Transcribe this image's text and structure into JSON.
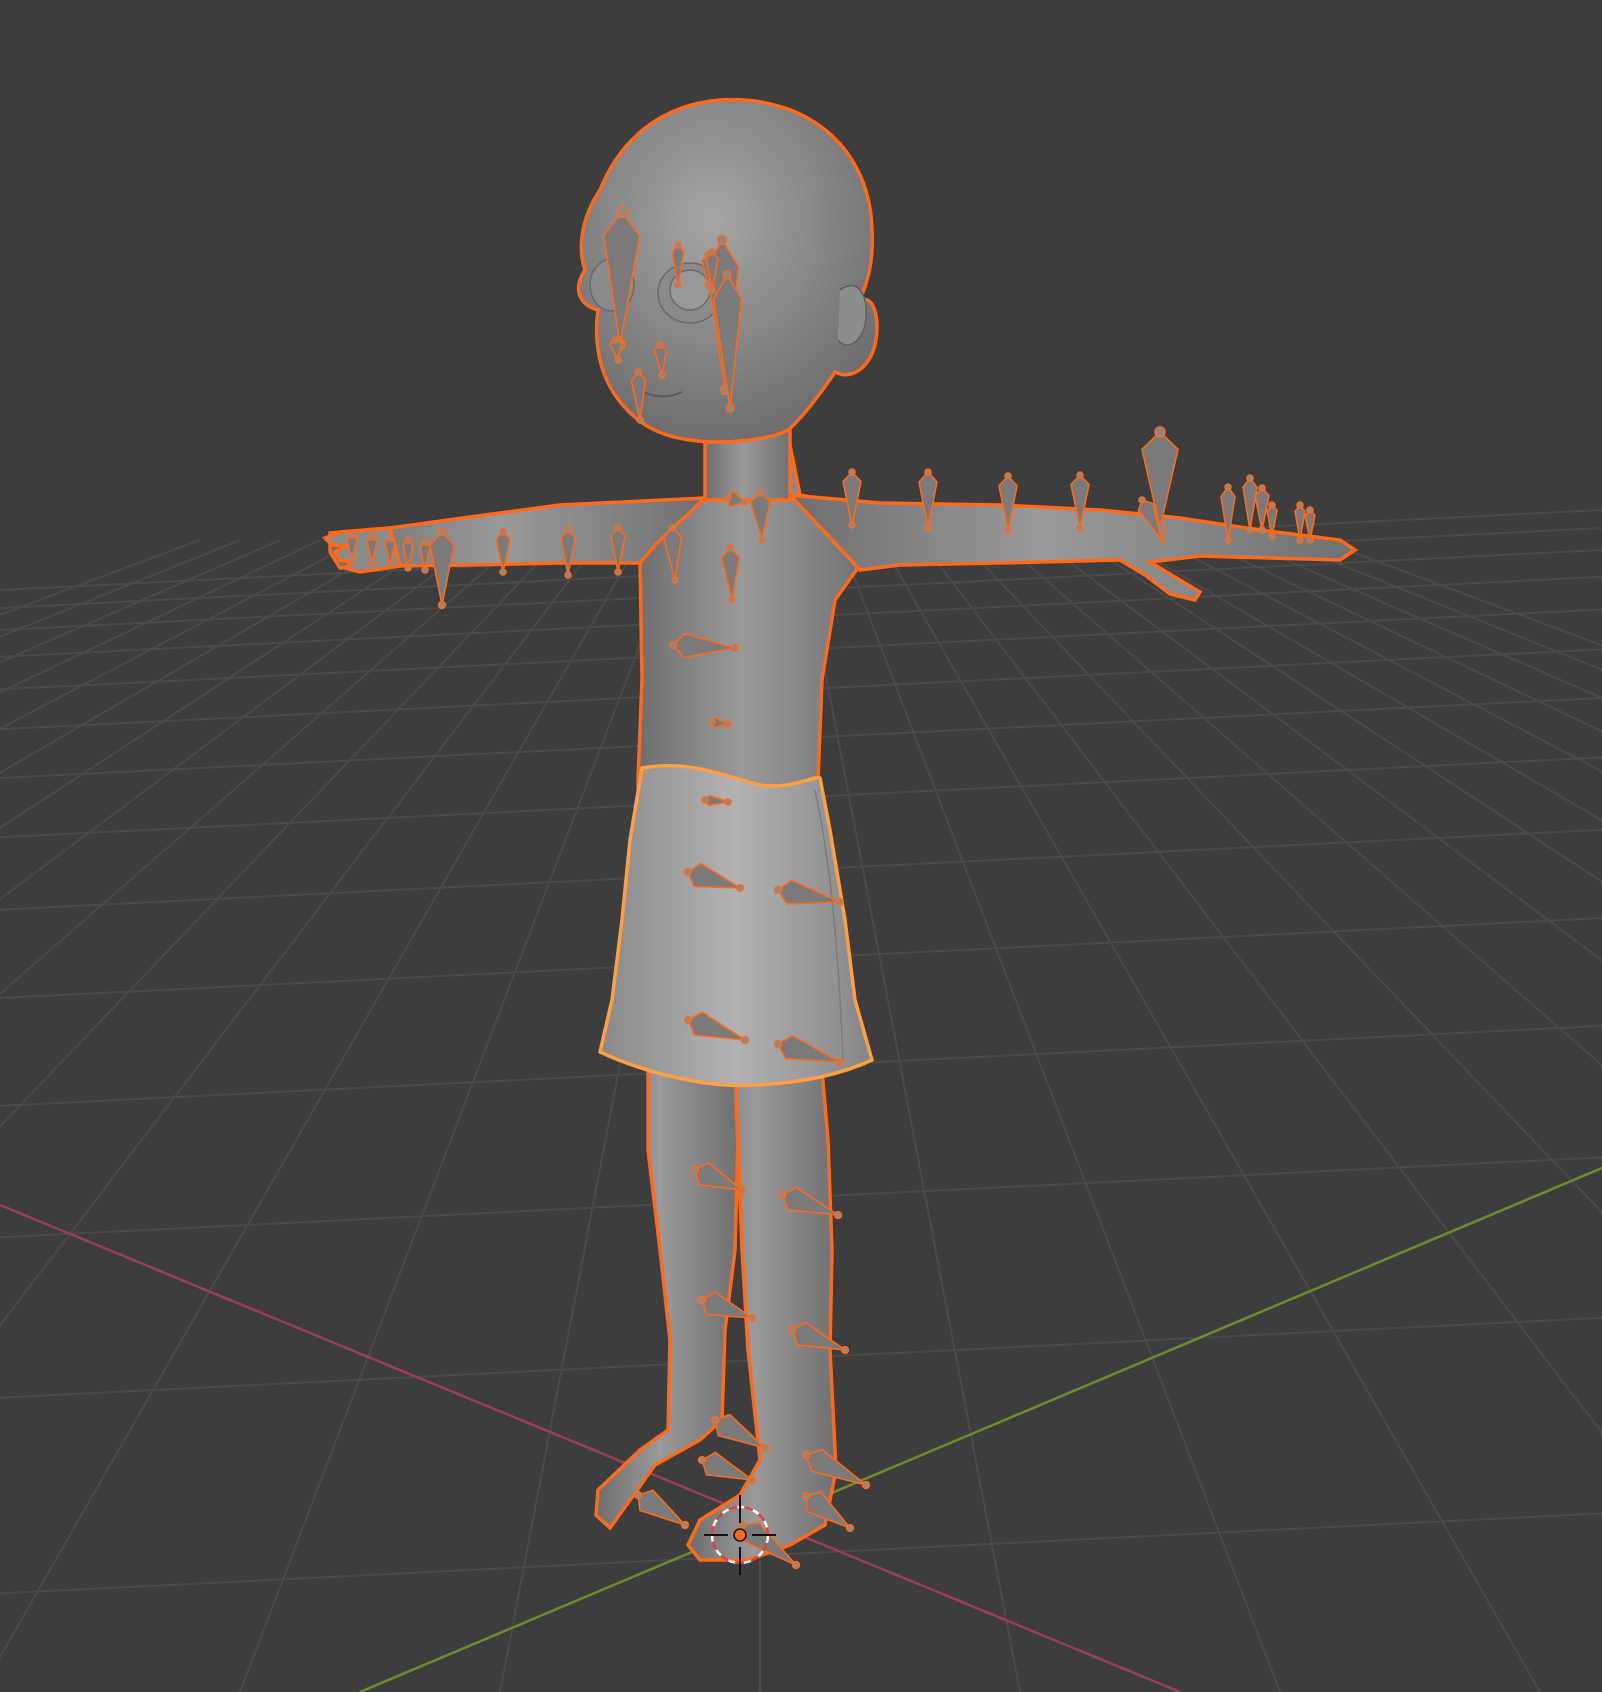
{
  "viewport": {
    "name": "3D Viewport",
    "background": "#3d3d3d"
  },
  "colors": {
    "grid": "#4a4a4a",
    "x_axis": "#9c3f55",
    "y_axis": "#6d8f2b",
    "selection_outline": "#ff6a1a",
    "active_outline": "#ffa040",
    "mesh": "#8d8d8d",
    "bone": "#7a7a7a"
  },
  "icons": {
    "cursor": "3d-cursor-icon"
  },
  "scene": {
    "objects": [
      {
        "label": "character-body",
        "type": "mesh",
        "selected": true
      },
      {
        "label": "skirt",
        "type": "mesh",
        "selected": true,
        "active": true
      },
      {
        "label": "armature",
        "type": "armature",
        "selected": true
      }
    ]
  }
}
